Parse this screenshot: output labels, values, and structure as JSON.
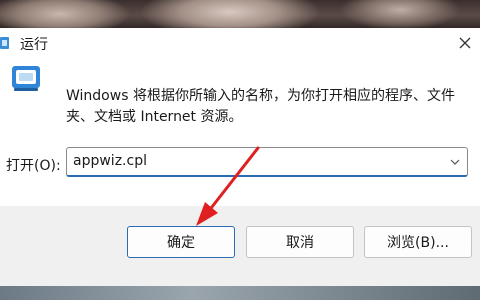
{
  "window": {
    "title": "运行"
  },
  "main": {
    "description": "Windows 将根据你所输入的名称，为你打开相应的程序、文件夹、文档或 Internet 资源。",
    "open_label": "打开(O):",
    "command_value": "appwiz.cpl"
  },
  "buttons": {
    "ok": "确定",
    "cancel": "取消",
    "browse": "浏览(B)..."
  },
  "icons": {
    "title": "run-icon",
    "content": "run-dialog-icon",
    "close": "close-icon",
    "dropdown": "chevron-down-icon"
  },
  "colors": {
    "accent": "#2b6cb0",
    "annotation_arrow": "#e02020"
  }
}
